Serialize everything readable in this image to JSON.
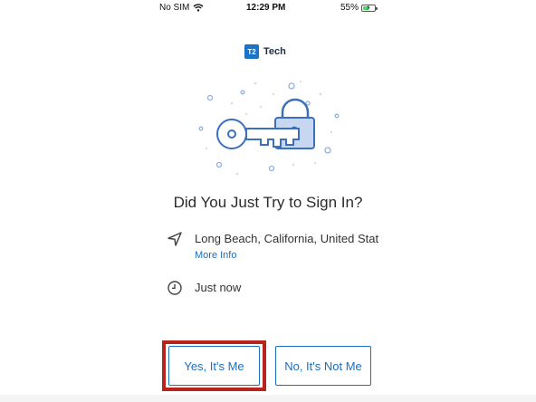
{
  "status_bar": {
    "carrier": "No SIM",
    "time": "12:29 PM",
    "battery_percent": "55%",
    "battery_level": 0.55,
    "wifi_icon": "wifi-icon",
    "battery_icon": "battery-charging-icon"
  },
  "brand": {
    "badge": "T2",
    "name": "Tech"
  },
  "illustration": {
    "icon": "key-and-padlock-illustration",
    "accent_color": "#3d6fbf",
    "fill_color": "#c7d7f2"
  },
  "prompt": {
    "title": "Did You Just Try to Sign In?",
    "location": "Long Beach, California, United Stat",
    "more_info": "More Info",
    "time": "Just now",
    "location_icon": "location-arrow-icon",
    "clock_icon": "clock-icon"
  },
  "actions": {
    "yes_label": "Yes, It's Me",
    "no_label": "No, It's Not Me",
    "highlight_color": "#b8241c",
    "button_color": "#1a6fbf"
  }
}
